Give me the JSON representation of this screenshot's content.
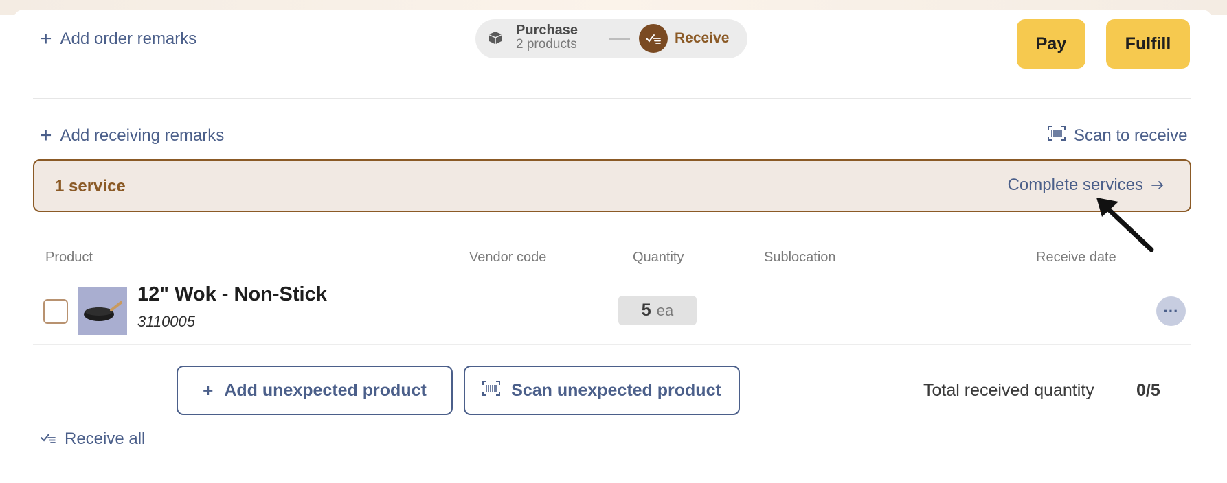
{
  "header": {
    "add_order_remarks": "Add order remarks",
    "stepper": {
      "step1_title": "Purchase",
      "step1_subtitle": "2 products",
      "step2_title": "Receive"
    },
    "pay_label": "Pay",
    "fulfill_label": "Fulfill"
  },
  "receiving": {
    "add_receiving_remarks": "Add receiving remarks",
    "scan_to_receive": "Scan to receive"
  },
  "services": {
    "count_label": "1 service",
    "complete_label": "Complete services"
  },
  "table": {
    "columns": [
      "Product",
      "Vendor code",
      "Quantity",
      "Sublocation",
      "Receive date"
    ],
    "rows": [
      {
        "name": "12\" Wok - Non-Stick",
        "sku": "3110005",
        "quantity": "5",
        "unit": "ea"
      }
    ]
  },
  "actions": {
    "add_unexpected": "Add unexpected product",
    "scan_unexpected": "Scan unexpected product",
    "total_label": "Total received quantity",
    "total_value": "0/5",
    "receive_all": "Receive all"
  },
  "colors": {
    "accent_blue": "#4b5f8a",
    "brand_brown": "#8b5a26",
    "button_yellow": "#f6c94f",
    "service_bg": "#f1e9e3"
  }
}
